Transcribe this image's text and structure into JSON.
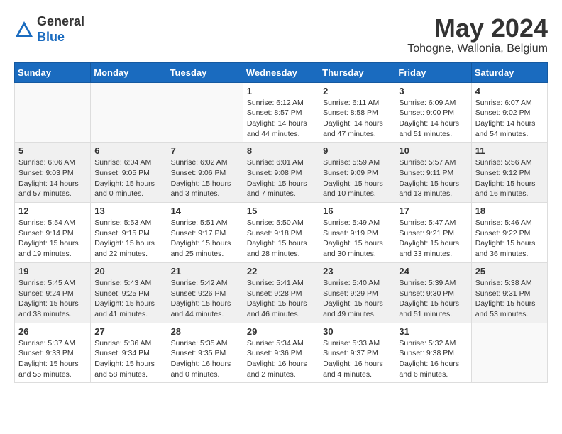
{
  "header": {
    "logo_general": "General",
    "logo_blue": "Blue",
    "month_title": "May 2024",
    "location": "Tohogne, Wallonia, Belgium"
  },
  "days_of_week": [
    "Sunday",
    "Monday",
    "Tuesday",
    "Wednesday",
    "Thursday",
    "Friday",
    "Saturday"
  ],
  "weeks": [
    [
      {
        "day": "",
        "info": ""
      },
      {
        "day": "",
        "info": ""
      },
      {
        "day": "",
        "info": ""
      },
      {
        "day": "1",
        "info": "Sunrise: 6:12 AM\nSunset: 8:57 PM\nDaylight: 14 hours\nand 44 minutes."
      },
      {
        "day": "2",
        "info": "Sunrise: 6:11 AM\nSunset: 8:58 PM\nDaylight: 14 hours\nand 47 minutes."
      },
      {
        "day": "3",
        "info": "Sunrise: 6:09 AM\nSunset: 9:00 PM\nDaylight: 14 hours\nand 51 minutes."
      },
      {
        "day": "4",
        "info": "Sunrise: 6:07 AM\nSunset: 9:02 PM\nDaylight: 14 hours\nand 54 minutes."
      }
    ],
    [
      {
        "day": "5",
        "info": "Sunrise: 6:06 AM\nSunset: 9:03 PM\nDaylight: 14 hours\nand 57 minutes."
      },
      {
        "day": "6",
        "info": "Sunrise: 6:04 AM\nSunset: 9:05 PM\nDaylight: 15 hours\nand 0 minutes."
      },
      {
        "day": "7",
        "info": "Sunrise: 6:02 AM\nSunset: 9:06 PM\nDaylight: 15 hours\nand 3 minutes."
      },
      {
        "day": "8",
        "info": "Sunrise: 6:01 AM\nSunset: 9:08 PM\nDaylight: 15 hours\nand 7 minutes."
      },
      {
        "day": "9",
        "info": "Sunrise: 5:59 AM\nSunset: 9:09 PM\nDaylight: 15 hours\nand 10 minutes."
      },
      {
        "day": "10",
        "info": "Sunrise: 5:57 AM\nSunset: 9:11 PM\nDaylight: 15 hours\nand 13 minutes."
      },
      {
        "day": "11",
        "info": "Sunrise: 5:56 AM\nSunset: 9:12 PM\nDaylight: 15 hours\nand 16 minutes."
      }
    ],
    [
      {
        "day": "12",
        "info": "Sunrise: 5:54 AM\nSunset: 9:14 PM\nDaylight: 15 hours\nand 19 minutes."
      },
      {
        "day": "13",
        "info": "Sunrise: 5:53 AM\nSunset: 9:15 PM\nDaylight: 15 hours\nand 22 minutes."
      },
      {
        "day": "14",
        "info": "Sunrise: 5:51 AM\nSunset: 9:17 PM\nDaylight: 15 hours\nand 25 minutes."
      },
      {
        "day": "15",
        "info": "Sunrise: 5:50 AM\nSunset: 9:18 PM\nDaylight: 15 hours\nand 28 minutes."
      },
      {
        "day": "16",
        "info": "Sunrise: 5:49 AM\nSunset: 9:19 PM\nDaylight: 15 hours\nand 30 minutes."
      },
      {
        "day": "17",
        "info": "Sunrise: 5:47 AM\nSunset: 9:21 PM\nDaylight: 15 hours\nand 33 minutes."
      },
      {
        "day": "18",
        "info": "Sunrise: 5:46 AM\nSunset: 9:22 PM\nDaylight: 15 hours\nand 36 minutes."
      }
    ],
    [
      {
        "day": "19",
        "info": "Sunrise: 5:45 AM\nSunset: 9:24 PM\nDaylight: 15 hours\nand 38 minutes."
      },
      {
        "day": "20",
        "info": "Sunrise: 5:43 AM\nSunset: 9:25 PM\nDaylight: 15 hours\nand 41 minutes."
      },
      {
        "day": "21",
        "info": "Sunrise: 5:42 AM\nSunset: 9:26 PM\nDaylight: 15 hours\nand 44 minutes."
      },
      {
        "day": "22",
        "info": "Sunrise: 5:41 AM\nSunset: 9:28 PM\nDaylight: 15 hours\nand 46 minutes."
      },
      {
        "day": "23",
        "info": "Sunrise: 5:40 AM\nSunset: 9:29 PM\nDaylight: 15 hours\nand 49 minutes."
      },
      {
        "day": "24",
        "info": "Sunrise: 5:39 AM\nSunset: 9:30 PM\nDaylight: 15 hours\nand 51 minutes."
      },
      {
        "day": "25",
        "info": "Sunrise: 5:38 AM\nSunset: 9:31 PM\nDaylight: 15 hours\nand 53 minutes."
      }
    ],
    [
      {
        "day": "26",
        "info": "Sunrise: 5:37 AM\nSunset: 9:33 PM\nDaylight: 15 hours\nand 55 minutes."
      },
      {
        "day": "27",
        "info": "Sunrise: 5:36 AM\nSunset: 9:34 PM\nDaylight: 15 hours\nand 58 minutes."
      },
      {
        "day": "28",
        "info": "Sunrise: 5:35 AM\nSunset: 9:35 PM\nDaylight: 16 hours\nand 0 minutes."
      },
      {
        "day": "29",
        "info": "Sunrise: 5:34 AM\nSunset: 9:36 PM\nDaylight: 16 hours\nand 2 minutes."
      },
      {
        "day": "30",
        "info": "Sunrise: 5:33 AM\nSunset: 9:37 PM\nDaylight: 16 hours\nand 4 minutes."
      },
      {
        "day": "31",
        "info": "Sunrise: 5:32 AM\nSunset: 9:38 PM\nDaylight: 16 hours\nand 6 minutes."
      },
      {
        "day": "",
        "info": ""
      }
    ]
  ]
}
